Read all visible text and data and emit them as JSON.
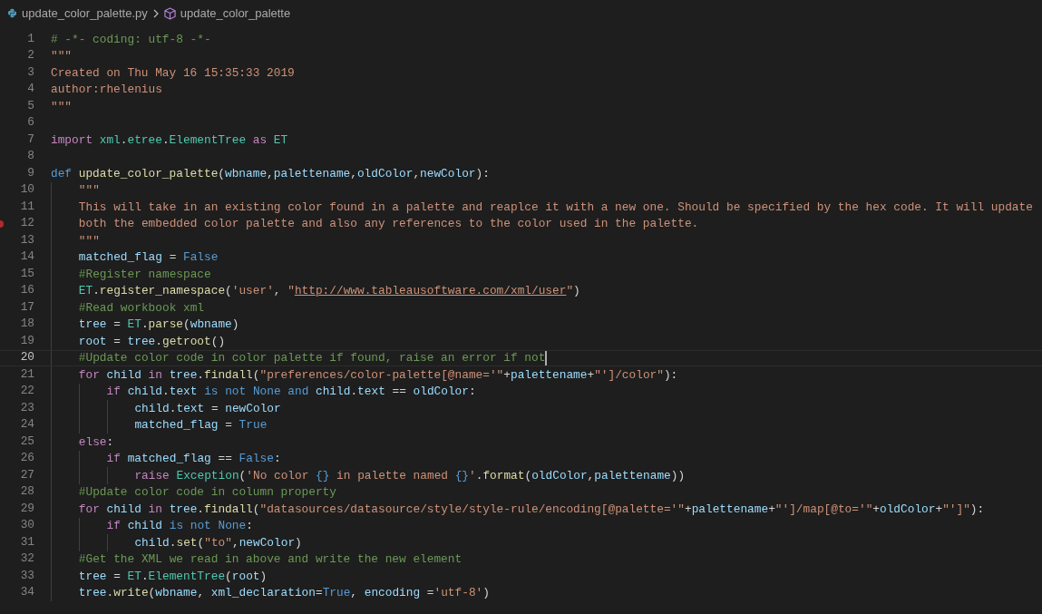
{
  "breadcrumb": {
    "file": "update_color_palette.py",
    "symbol": "update_color_palette"
  },
  "lines": [
    {
      "number": "1",
      "current": false,
      "breakpoint": false,
      "tokens": [
        {
          "kind": "c",
          "text": "# -*- coding: utf-8 -*-"
        }
      ]
    },
    {
      "number": "2",
      "current": false,
      "breakpoint": false,
      "tokens": [
        {
          "kind": "s",
          "text": "\"\"\""
        }
      ]
    },
    {
      "number": "3",
      "current": false,
      "breakpoint": false,
      "tokens": [
        {
          "kind": "s",
          "text": "Created on Thu May 16 15:35:33 2019"
        }
      ]
    },
    {
      "number": "4",
      "current": false,
      "breakpoint": false,
      "tokens": [
        {
          "kind": "s",
          "text": "author:rhelenius"
        }
      ]
    },
    {
      "number": "5",
      "current": false,
      "breakpoint": false,
      "tokens": [
        {
          "kind": "s",
          "text": "\"\"\""
        }
      ]
    },
    {
      "number": "6",
      "current": false,
      "breakpoint": false
    },
    {
      "number": "7",
      "current": false,
      "breakpoint": false,
      "tokens": [
        {
          "kind": "k",
          "text": "import "
        },
        {
          "kind": "t",
          "text": "xml"
        },
        {
          "kind": "p",
          "text": "."
        },
        {
          "kind": "t",
          "text": "etree"
        },
        {
          "kind": "p",
          "text": "."
        },
        {
          "kind": "t",
          "text": "ElementTree "
        },
        {
          "kind": "k",
          "text": "as "
        },
        {
          "kind": "t",
          "text": "ET"
        }
      ]
    },
    {
      "number": "8",
      "current": false,
      "breakpoint": false
    },
    {
      "number": "9",
      "current": false,
      "breakpoint": false,
      "tokens": [
        {
          "kind": "b",
          "text": "def "
        },
        {
          "kind": "f",
          "text": "update_color_palette"
        },
        {
          "kind": "p",
          "text": "("
        },
        {
          "kind": "v",
          "text": "wbname"
        },
        {
          "kind": "p",
          "text": ","
        },
        {
          "kind": "v",
          "text": "palettename"
        },
        {
          "kind": "p",
          "text": ","
        },
        {
          "kind": "v",
          "text": "oldColor"
        },
        {
          "kind": "p",
          "text": ","
        },
        {
          "kind": "v",
          "text": "newColor"
        },
        {
          "kind": "p",
          "text": "):"
        }
      ]
    },
    {
      "number": "10",
      "current": false,
      "breakpoint": false,
      "tokens": [
        {
          "kind": "s",
          "text": "    \"\"\""
        }
      ]
    },
    {
      "number": "11",
      "current": false,
      "breakpoint": false,
      "tokens": [
        {
          "kind": "s",
          "text": "    This will take in an existing color found in a palette and reaplce it with a new one. Should be specified by the hex code. It will update"
        }
      ]
    },
    {
      "number": "12",
      "current": false,
      "breakpoint": true,
      "tokens": [
        {
          "kind": "s",
          "text": "    both the embedded color palette and also any references to the color used in the palette."
        }
      ]
    },
    {
      "number": "13",
      "current": false,
      "breakpoint": false,
      "tokens": [
        {
          "kind": "s",
          "text": "    \"\"\""
        }
      ]
    },
    {
      "number": "14",
      "current": false,
      "breakpoint": false,
      "tokens": [
        {
          "kind": "v",
          "text": "    matched_flag"
        },
        {
          "kind": "p",
          "text": " = "
        },
        {
          "kind": "b",
          "text": "False"
        }
      ]
    },
    {
      "number": "15",
      "current": false,
      "breakpoint": false,
      "tokens": [
        {
          "kind": "c",
          "text": "    #Register namespace"
        }
      ]
    },
    {
      "number": "16",
      "current": false,
      "breakpoint": false,
      "tokens": [
        {
          "kind": "t",
          "text": "    ET"
        },
        {
          "kind": "p",
          "text": "."
        },
        {
          "kind": "f",
          "text": "register_namespace"
        },
        {
          "kind": "p",
          "text": "("
        },
        {
          "kind": "s",
          "text": "'user'"
        },
        {
          "kind": "p",
          "text": ", "
        },
        {
          "kind": "s",
          "text": "\""
        },
        {
          "kind": "u",
          "text": "http://www.tableausoftware.com/xml/user"
        },
        {
          "kind": "s",
          "text": "\""
        },
        {
          "kind": "p",
          "text": ")"
        }
      ]
    },
    {
      "number": "17",
      "current": false,
      "breakpoint": false,
      "tokens": [
        {
          "kind": "c",
          "text": "    #Read workbook xml"
        }
      ]
    },
    {
      "number": "18",
      "current": false,
      "breakpoint": false,
      "tokens": [
        {
          "kind": "v",
          "text": "    tree"
        },
        {
          "kind": "p",
          "text": " = "
        },
        {
          "kind": "t",
          "text": "ET"
        },
        {
          "kind": "p",
          "text": "."
        },
        {
          "kind": "f",
          "text": "parse"
        },
        {
          "kind": "p",
          "text": "("
        },
        {
          "kind": "v",
          "text": "wbname"
        },
        {
          "kind": "p",
          "text": ")"
        }
      ]
    },
    {
      "number": "19",
      "current": false,
      "breakpoint": false,
      "tokens": [
        {
          "kind": "v",
          "text": "    root"
        },
        {
          "kind": "p",
          "text": " = "
        },
        {
          "kind": "v",
          "text": "tree"
        },
        {
          "kind": "p",
          "text": "."
        },
        {
          "kind": "f",
          "text": "getroot"
        },
        {
          "kind": "p",
          "text": "()"
        }
      ]
    },
    {
      "number": "20",
      "current": true,
      "breakpoint": false,
      "tokens": [
        {
          "kind": "c",
          "text": "    #Update color code in color palette if found, raise an error if not"
        }
      ]
    },
    {
      "number": "21",
      "current": false,
      "breakpoint": false,
      "tokens": [
        {
          "kind": "k",
          "text": "    for "
        },
        {
          "kind": "v",
          "text": "child "
        },
        {
          "kind": "k",
          "text": "in "
        },
        {
          "kind": "v",
          "text": "tree"
        },
        {
          "kind": "p",
          "text": "."
        },
        {
          "kind": "f",
          "text": "findall"
        },
        {
          "kind": "p",
          "text": "("
        },
        {
          "kind": "s",
          "text": "\"preferences/color-palette[@name='\""
        },
        {
          "kind": "p",
          "text": "+"
        },
        {
          "kind": "v",
          "text": "palettename"
        },
        {
          "kind": "p",
          "text": "+"
        },
        {
          "kind": "s",
          "text": "\"']/color\""
        },
        {
          "kind": "p",
          "text": "):"
        }
      ]
    },
    {
      "number": "22",
      "current": false,
      "breakpoint": false,
      "tokens": [
        {
          "kind": "k",
          "text": "        if "
        },
        {
          "kind": "v",
          "text": "child"
        },
        {
          "kind": "p",
          "text": "."
        },
        {
          "kind": "v",
          "text": "text "
        },
        {
          "kind": "b",
          "text": "is not None and "
        },
        {
          "kind": "v",
          "text": "child"
        },
        {
          "kind": "p",
          "text": "."
        },
        {
          "kind": "v",
          "text": "text"
        },
        {
          "kind": "p",
          "text": " == "
        },
        {
          "kind": "v",
          "text": "oldColor"
        },
        {
          "kind": "p",
          "text": ":"
        }
      ]
    },
    {
      "number": "23",
      "current": false,
      "breakpoint": false,
      "tokens": [
        {
          "kind": "v",
          "text": "            child"
        },
        {
          "kind": "p",
          "text": "."
        },
        {
          "kind": "v",
          "text": "text"
        },
        {
          "kind": "p",
          "text": " = "
        },
        {
          "kind": "v",
          "text": "newColor"
        }
      ]
    },
    {
      "number": "24",
      "current": false,
      "breakpoint": false,
      "tokens": [
        {
          "kind": "v",
          "text": "            matched_flag"
        },
        {
          "kind": "p",
          "text": " = "
        },
        {
          "kind": "b",
          "text": "True"
        }
      ]
    },
    {
      "number": "25",
      "current": false,
      "breakpoint": false,
      "tokens": [
        {
          "kind": "k",
          "text": "    else"
        },
        {
          "kind": "p",
          "text": ":"
        }
      ]
    },
    {
      "number": "26",
      "current": false,
      "breakpoint": false,
      "tokens": [
        {
          "kind": "k",
          "text": "        if "
        },
        {
          "kind": "v",
          "text": "matched_flag"
        },
        {
          "kind": "p",
          "text": " == "
        },
        {
          "kind": "b",
          "text": "False"
        },
        {
          "kind": "p",
          "text": ":"
        }
      ]
    },
    {
      "number": "27",
      "current": false,
      "breakpoint": false,
      "tokens": [
        {
          "kind": "k",
          "text": "            raise "
        },
        {
          "kind": "t",
          "text": "Exception"
        },
        {
          "kind": "p",
          "text": "("
        },
        {
          "kind": "s",
          "text": "'No color "
        },
        {
          "kind": "b",
          "text": "{}"
        },
        {
          "kind": "s",
          "text": " in palette named "
        },
        {
          "kind": "b",
          "text": "{}"
        },
        {
          "kind": "s",
          "text": "'"
        },
        {
          "kind": "p",
          "text": "."
        },
        {
          "kind": "f",
          "text": "format"
        },
        {
          "kind": "p",
          "text": "("
        },
        {
          "kind": "v",
          "text": "oldColor"
        },
        {
          "kind": "p",
          "text": ","
        },
        {
          "kind": "v",
          "text": "palettename"
        },
        {
          "kind": "p",
          "text": "))"
        }
      ]
    },
    {
      "number": "28",
      "current": false,
      "breakpoint": false,
      "tokens": [
        {
          "kind": "c",
          "text": "    #Update color code in column property"
        }
      ]
    },
    {
      "number": "29",
      "current": false,
      "breakpoint": false,
      "tokens": [
        {
          "kind": "k",
          "text": "    for "
        },
        {
          "kind": "v",
          "text": "child "
        },
        {
          "kind": "k",
          "text": "in "
        },
        {
          "kind": "v",
          "text": "tree"
        },
        {
          "kind": "p",
          "text": "."
        },
        {
          "kind": "f",
          "text": "findall"
        },
        {
          "kind": "p",
          "text": "("
        },
        {
          "kind": "s",
          "text": "\"datasources/datasource/style/style-rule/encoding[@palette='\""
        },
        {
          "kind": "p",
          "text": "+"
        },
        {
          "kind": "v",
          "text": "palettename"
        },
        {
          "kind": "p",
          "text": "+"
        },
        {
          "kind": "s",
          "text": "\"']/map[@to='\""
        },
        {
          "kind": "p",
          "text": "+"
        },
        {
          "kind": "v",
          "text": "oldColor"
        },
        {
          "kind": "p",
          "text": "+"
        },
        {
          "kind": "s",
          "text": "\"']\""
        },
        {
          "kind": "p",
          "text": "):"
        }
      ]
    },
    {
      "number": "30",
      "current": false,
      "breakpoint": false,
      "tokens": [
        {
          "kind": "k",
          "text": "        if "
        },
        {
          "kind": "v",
          "text": "child "
        },
        {
          "kind": "b",
          "text": "is not None"
        },
        {
          "kind": "p",
          "text": ":"
        }
      ]
    },
    {
      "number": "31",
      "current": false,
      "breakpoint": false,
      "tokens": [
        {
          "kind": "v",
          "text": "            child"
        },
        {
          "kind": "p",
          "text": "."
        },
        {
          "kind": "f",
          "text": "set"
        },
        {
          "kind": "p",
          "text": "("
        },
        {
          "kind": "s",
          "text": "\"to\""
        },
        {
          "kind": "p",
          "text": ","
        },
        {
          "kind": "v",
          "text": "newColor"
        },
        {
          "kind": "p",
          "text": ")"
        }
      ]
    },
    {
      "number": "32",
      "current": false,
      "breakpoint": false,
      "tokens": [
        {
          "kind": "c",
          "text": "    #Get the XML we read in above and write the new element"
        }
      ]
    },
    {
      "number": "33",
      "current": false,
      "breakpoint": false,
      "tokens": [
        {
          "kind": "v",
          "text": "    tree"
        },
        {
          "kind": "p",
          "text": " = "
        },
        {
          "kind": "t",
          "text": "ET"
        },
        {
          "kind": "p",
          "text": "."
        },
        {
          "kind": "t",
          "text": "ElementTree"
        },
        {
          "kind": "p",
          "text": "("
        },
        {
          "kind": "v",
          "text": "root"
        },
        {
          "kind": "p",
          "text": ")"
        }
      ]
    },
    {
      "number": "34",
      "current": false,
      "breakpoint": false,
      "tokens": [
        {
          "kind": "v",
          "text": "    tree"
        },
        {
          "kind": "p",
          "text": "."
        },
        {
          "kind": "f",
          "text": "write"
        },
        {
          "kind": "p",
          "text": "("
        },
        {
          "kind": "v",
          "text": "wbname"
        },
        {
          "kind": "p",
          "text": ", "
        },
        {
          "kind": "v",
          "text": "xml_declaration"
        },
        {
          "kind": "p",
          "text": "="
        },
        {
          "kind": "b",
          "text": "True"
        },
        {
          "kind": "p",
          "text": ", "
        },
        {
          "kind": "v",
          "text": "encoding "
        },
        {
          "kind": "p",
          "text": "="
        },
        {
          "kind": "s",
          "text": "'utf-8'"
        },
        {
          "kind": "p",
          "text": ")"
        }
      ]
    }
  ]
}
